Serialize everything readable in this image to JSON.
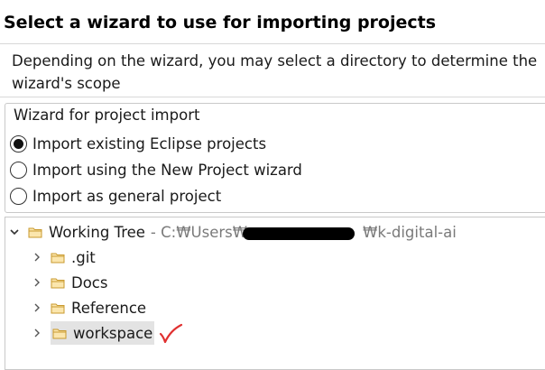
{
  "page": {
    "title": "Select a wizard to use for importing projects",
    "description": "Depending on the wizard, you may select a directory to determine the wizard's scope"
  },
  "import_group": {
    "legend": "Wizard for project import",
    "options": [
      {
        "label": "Import existing Eclipse projects",
        "selected": true
      },
      {
        "label": "Import using the New Project wizard",
        "selected": false
      },
      {
        "label": "Import as general project",
        "selected": false
      }
    ]
  },
  "tree": {
    "root": {
      "label": "Working Tree",
      "path_prefix": "- C:₩Users₩",
      "path_suffix": "₩k-digital-ai",
      "expanded": true,
      "icon": "folder-icon"
    },
    "children": [
      {
        "label": ".git",
        "icon": "folder-icon",
        "expanded": false,
        "selected": false
      },
      {
        "label": "Docs",
        "icon": "folder-icon",
        "expanded": false,
        "selected": false
      },
      {
        "label": "Reference",
        "icon": "folder-icon",
        "expanded": false,
        "selected": false
      },
      {
        "label": "workspace",
        "icon": "folder-icon",
        "expanded": false,
        "selected": true
      }
    ]
  },
  "colors": {
    "selection": "#e3e3e3",
    "folder": "#f2c25b",
    "annotation": "#e03030",
    "path_text": "#7a7a7a"
  }
}
